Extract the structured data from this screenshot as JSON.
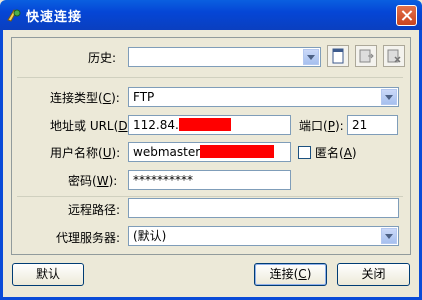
{
  "window": {
    "title": "快速连接"
  },
  "history": {
    "label": "历史:",
    "value": ""
  },
  "conn_type": {
    "label_pre": "连接类型(",
    "label_key": "C",
    "label_post": "):",
    "value": "FTP"
  },
  "address": {
    "label_pre": "地址或 URL(",
    "label_key": "D",
    "label_post": "):",
    "value_prefix": "112.84."
  },
  "port": {
    "label_pre": "端口(",
    "label_key": "P",
    "label_post": "):",
    "value": "21"
  },
  "username": {
    "label_pre": "用户名称(",
    "label_key": "U",
    "label_post": "):",
    "value_prefix": "webmaster"
  },
  "anonymous": {
    "label_pre": "匿名(",
    "label_key": "A",
    "label_post": ")",
    "checked": false
  },
  "password": {
    "label_pre": "密码(",
    "label_key": "W",
    "label_post": "):",
    "value": "**********"
  },
  "remote_path": {
    "label": "远程路径:",
    "value": ""
  },
  "proxy": {
    "label": "代理服务器:",
    "value": "(默认)"
  },
  "buttons": {
    "default": "默认",
    "connect_pre": "连接(",
    "connect_key": "C",
    "connect_post": ")",
    "close": "关闭"
  },
  "colors": {
    "redaction": "#ff0000",
    "titlebar": "#0546d6"
  }
}
